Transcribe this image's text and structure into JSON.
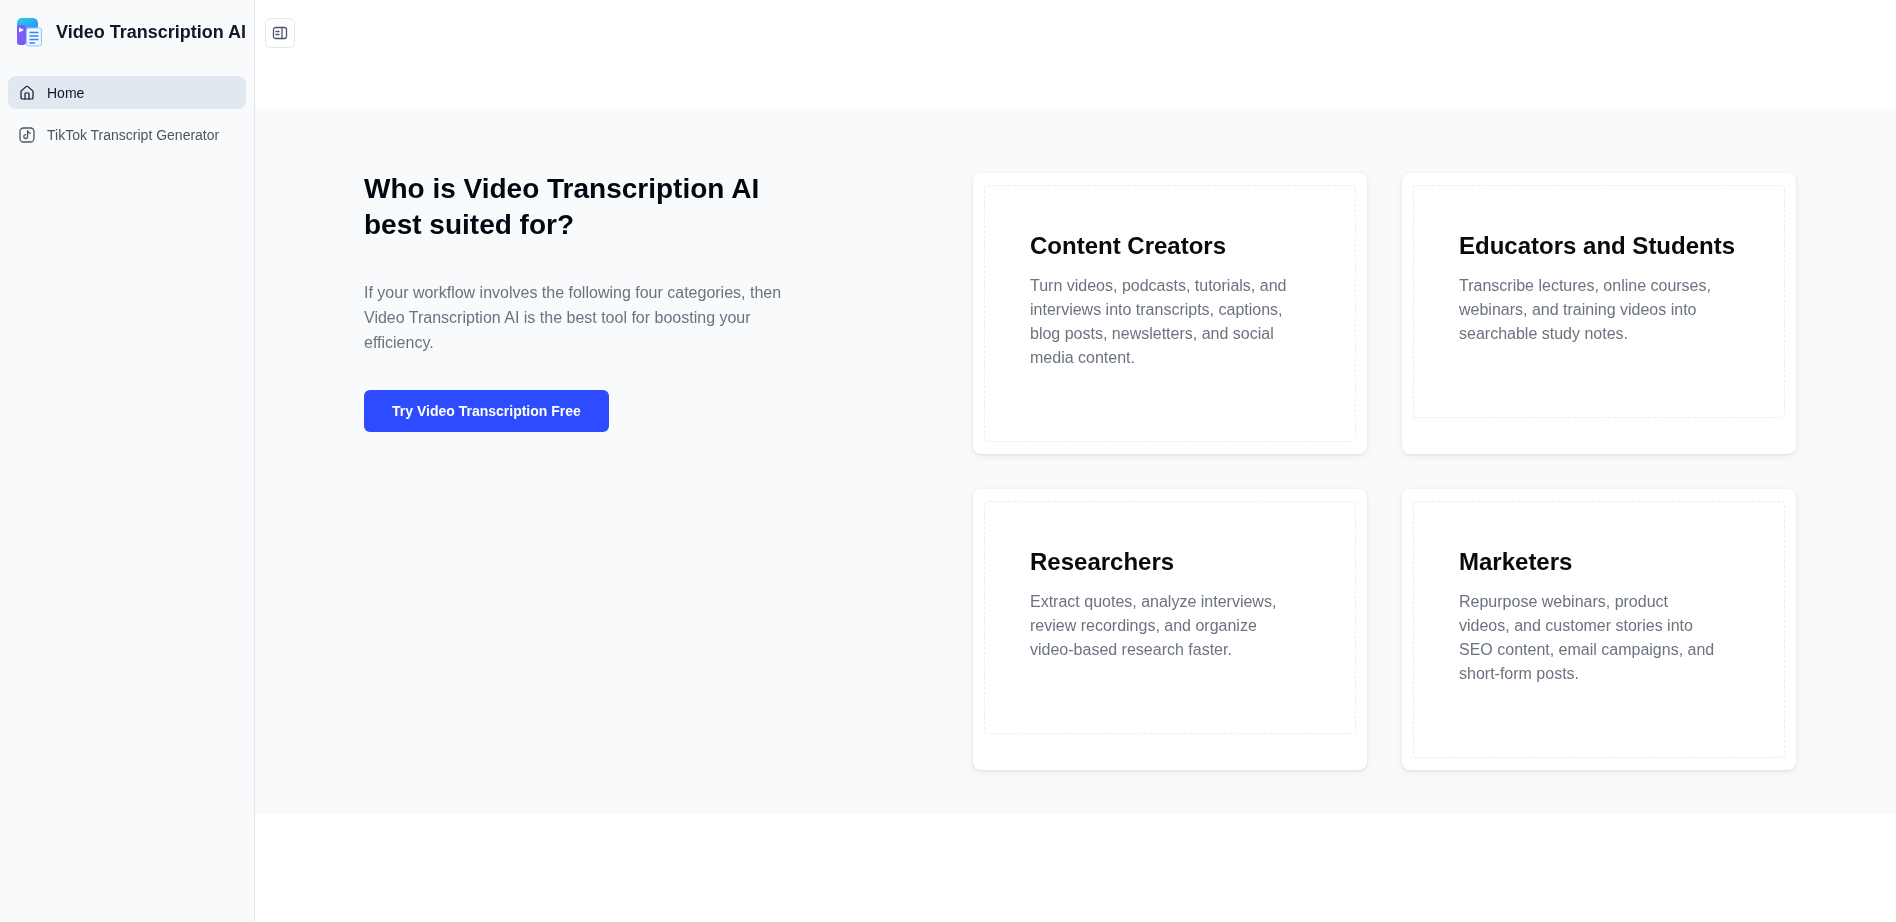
{
  "sidebar": {
    "app_title": "Video Transcription AI",
    "items": [
      {
        "label": "Home",
        "selected": true
      },
      {
        "label": "TikTok Transcript Generator",
        "selected": false
      }
    ]
  },
  "audience_section": {
    "heading": "Who is Video Transcription AI best suited for?",
    "description": "If your workflow involves the following four categories, then Video Transcription AI is the best tool for boosting your efficiency.",
    "cta_button": "Try Video Transcription Free",
    "cards": [
      {
        "title": "Content Creators",
        "text": "Turn videos, podcasts, tutorials, and interviews into transcripts, captions, blog posts, newsletters, and social media content."
      },
      {
        "title": "Educators and Students",
        "text": "Transcribe lectures, online courses, webinars, and training videos into searchable study notes."
      },
      {
        "title": "Researchers",
        "text": "Extract quotes, analyze interviews, review recordings, and organize video-based research faster."
      },
      {
        "title": "Marketers",
        "text": "Repurpose webinars, product videos, and customer stories into SEO content, email campaigns, and short-form posts."
      }
    ]
  }
}
